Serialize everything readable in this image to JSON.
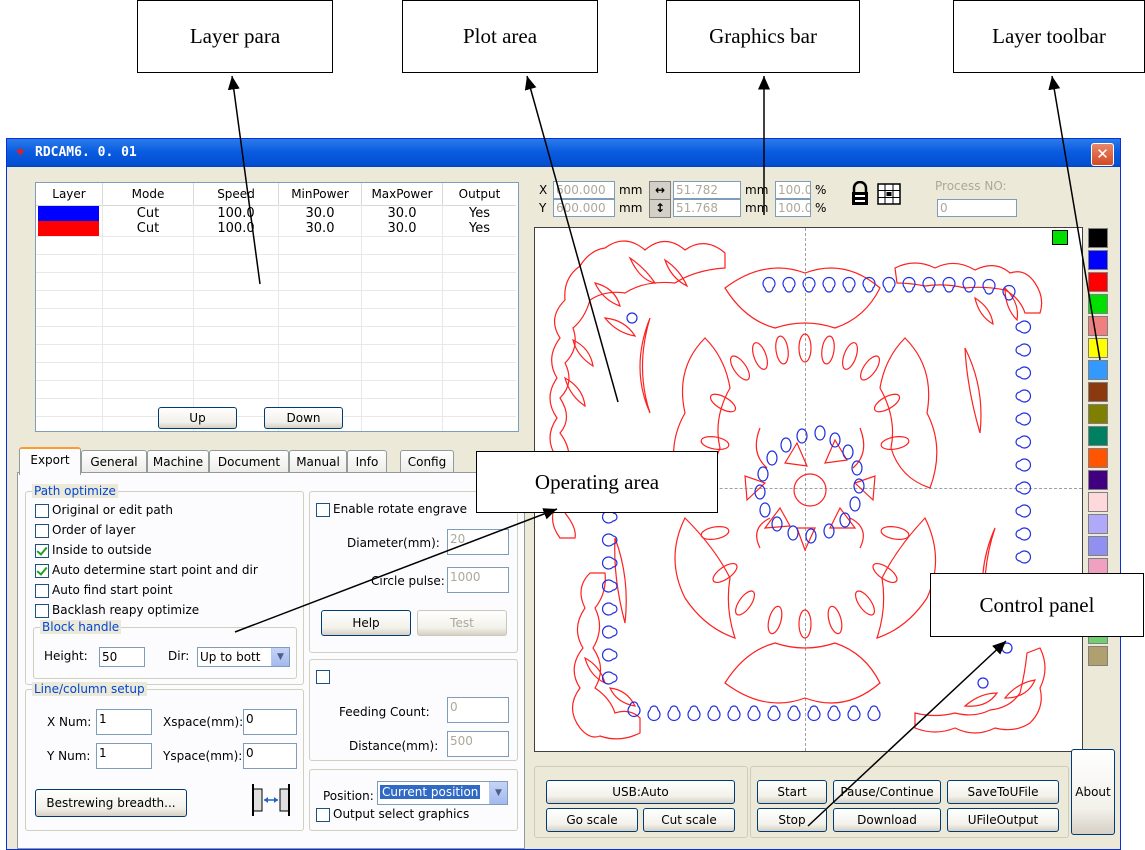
{
  "callouts": {
    "layer_para": "Layer para",
    "plot_area": "Plot area",
    "graphics_bar": "Graphics bar",
    "layer_toolbar": "Layer toolbar",
    "operating_area": "Operating area",
    "control_panel": "Control panel"
  },
  "window": {
    "title": "RDCAM6. 0. 01",
    "close": "✕"
  },
  "layer_table": {
    "headers": [
      "Layer",
      "Mode",
      "Speed",
      "MinPower",
      "MaxPower",
      "Output"
    ],
    "rows": [
      {
        "color": "#0000FF",
        "mode": "Cut",
        "speed": "100.0",
        "min": "30.0",
        "max": "30.0",
        "output": "Yes"
      },
      {
        "color": "#FF0000",
        "mode": "Cut",
        "speed": "100.0",
        "min": "30.0",
        "max": "30.0",
        "output": "Yes"
      }
    ],
    "up": "Up",
    "down": "Down"
  },
  "tabs": [
    "Export",
    "General",
    "Machine",
    "Document",
    "Manual",
    "Info",
    "Config"
  ],
  "export": {
    "path_optimize": "Path optimize",
    "options": [
      {
        "label": "Original or edit path",
        "checked": false
      },
      {
        "label": "Order of layer",
        "checked": false
      },
      {
        "label": "Inside to outside",
        "checked": true
      },
      {
        "label": "Auto determine start point and dir",
        "checked": true
      },
      {
        "label": "Auto find start point",
        "checked": false
      },
      {
        "label": "Backlash reapy optimize",
        "checked": false
      }
    ],
    "block_handle": "Block handle",
    "height_label": "Height:",
    "height_value": "50",
    "dir_label": "Dir:",
    "dir_value": "Up to bott",
    "line_column": "Line/column setup",
    "xnum_label": "X Num:",
    "xnum": "1",
    "xspace_label": "Xspace(mm):",
    "xspace": "0",
    "ynum_label": "Y Num:",
    "ynum": "1",
    "yspace_label": "Yspace(mm):",
    "yspace": "0",
    "bestrewing": "Bestrewing breadth...",
    "rotate_label": "Enable rotate engrave",
    "diameter_label": "Diameter(mm):",
    "diameter": "20",
    "circle_label": "Circle pulse:",
    "circle": "1000",
    "help": "Help",
    "test": "Test",
    "feeding_label": "Feeding Count:",
    "feeding": "0",
    "distance_label": "Distance(mm):",
    "distance": "500",
    "position_label": "Position:",
    "position_value": "Current position",
    "output_select": "Output select graphics"
  },
  "graphics_bar": {
    "x_label": "X",
    "y_label": "Y",
    "x_pos": "600.000",
    "y_pos": "600.000",
    "mm": "mm",
    "width": "51.782",
    "height": "51.768",
    "scale_x": "100.0",
    "scale_y": "100.0",
    "pct": "%",
    "process_label": "Process NO:",
    "process": "0"
  },
  "layer_colors": [
    "#000000",
    "#0000FF",
    "#FF0000",
    "#00E000",
    "#F08080",
    "#FFFF00",
    "#3399FF",
    "#8B3A0F",
    "#808000",
    "#008060",
    "#FF5500",
    "#400080",
    "#FFD8DC",
    "#B0A8F8",
    "#9090F0",
    "#F0A0C0",
    "#D06890",
    "#9080D8",
    "#70D070",
    "#B0A070"
  ],
  "control": {
    "usb": "USB:Auto",
    "go_scale": "Go scale",
    "cut_scale": "Cut scale",
    "start": "Start",
    "pause": "Pause/Continue",
    "save_u": "SaveToUFile",
    "stop": "Stop",
    "download": "Download",
    "ufile_output": "UFileOutput",
    "about": "About"
  }
}
